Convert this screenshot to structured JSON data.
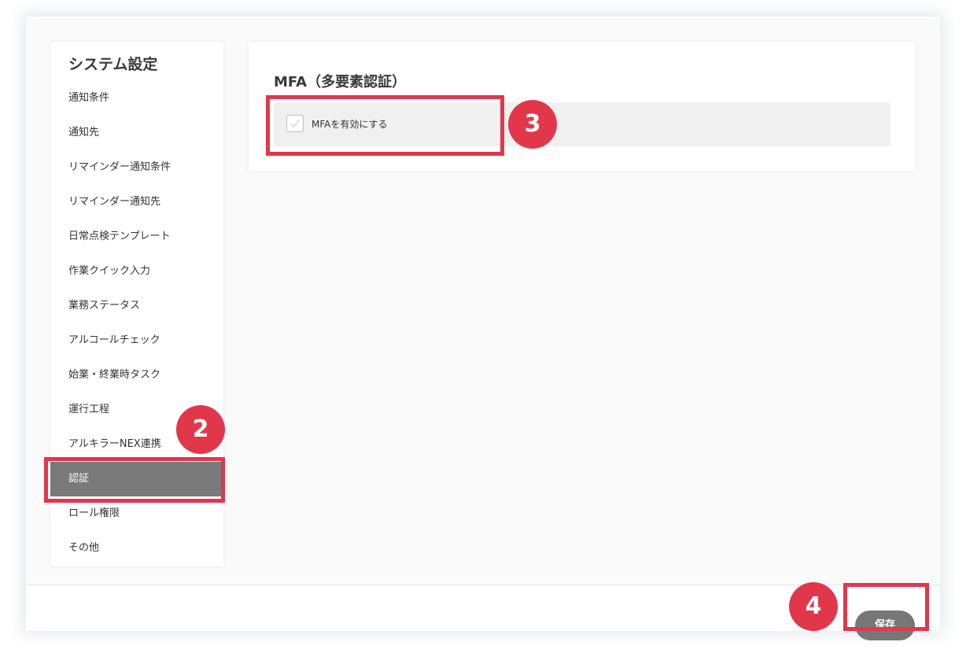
{
  "sidebar": {
    "title": "システム設定",
    "items": [
      {
        "label": "通知条件"
      },
      {
        "label": "通知先"
      },
      {
        "label": "リマインダー通知条件"
      },
      {
        "label": "リマインダー通知先"
      },
      {
        "label": "日常点検テンプレート"
      },
      {
        "label": "作業クイック入力"
      },
      {
        "label": "業務ステータス"
      },
      {
        "label": "アルコールチェック"
      },
      {
        "label": "始業・終業時タスク"
      },
      {
        "label": "運行工程"
      },
      {
        "label": "アルキラーNEX連携"
      },
      {
        "label": "認証",
        "active": true
      },
      {
        "label": "ロール権限"
      },
      {
        "label": "その他"
      }
    ]
  },
  "main": {
    "section_title": "MFA（多要素認証）",
    "mfa_checkbox": {
      "label": "MFAを有効にする",
      "checked": false
    }
  },
  "footer": {
    "save_label": "保存"
  },
  "annotations": {
    "step2": "2",
    "step3": "3",
    "step4": "4"
  },
  "colors": {
    "highlight": "#e2374a",
    "active_item": "#7a7a7a",
    "save_button": "#777777"
  }
}
